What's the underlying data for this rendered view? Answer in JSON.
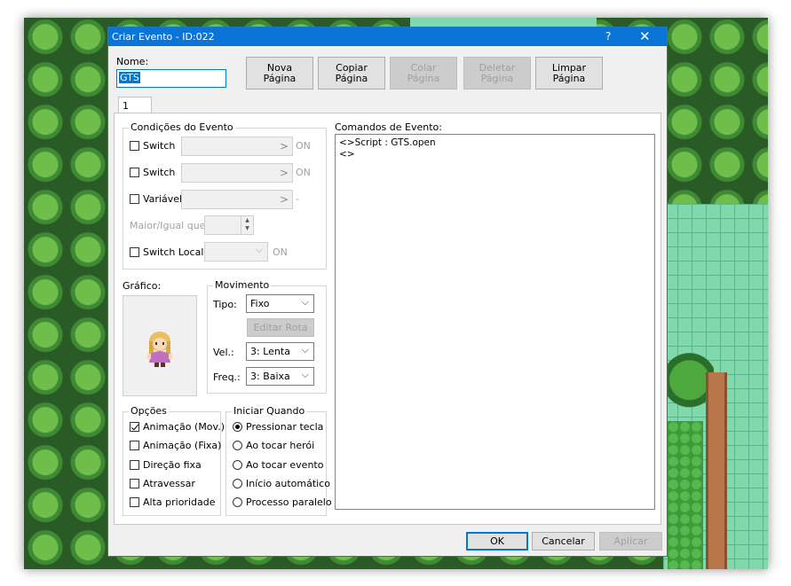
{
  "window": {
    "title": "Criar Evento - ID:022",
    "help": "?",
    "close": "✕"
  },
  "name": {
    "label": "Nome:",
    "value": "GTS"
  },
  "toolbar": {
    "new_page": [
      "Nova",
      "Página"
    ],
    "copy_page": [
      "Copiar",
      "Página"
    ],
    "paste_page": [
      "Colar",
      "Página"
    ],
    "delete_page": [
      "Deletar",
      "Página"
    ],
    "clear_page": [
      "Limpar",
      "Página"
    ]
  },
  "tabs": [
    "1"
  ],
  "conditions": {
    "title": "Condições do Evento",
    "switch1": {
      "label": "Switch",
      "arrow": ">",
      "suffix": "ON"
    },
    "switch2": {
      "label": "Switch",
      "arrow": ">",
      "suffix": "ON"
    },
    "variable": {
      "label": "Variável",
      "arrow": ">",
      "suffix": "-"
    },
    "greater_equal": "Maior/Igual que",
    "local_switch": {
      "label": "Switch Local",
      "suffix": "ON"
    }
  },
  "graphic": {
    "label": "Gráfico:"
  },
  "movement": {
    "title": "Movimento",
    "type_label": "Tipo:",
    "type_value": "Fixo",
    "edit_route": "Editar Rota",
    "speed_label": "Vel.:",
    "speed_value": "3: Lenta",
    "freq_label": "Freq.:",
    "freq_value": "3: Baixa"
  },
  "options": {
    "title": "Opções",
    "items": [
      {
        "label": "Animação (Mov.)",
        "checked": true
      },
      {
        "label": "Animação (Fixa)",
        "checked": false
      },
      {
        "label": "Direção fixa",
        "checked": false
      },
      {
        "label": "Atravessar",
        "checked": false
      },
      {
        "label": "Alta prioridade",
        "checked": false
      }
    ]
  },
  "trigger": {
    "title": "Iniciar Quando",
    "items": [
      {
        "label": "Pressionar tecla",
        "checked": true
      },
      {
        "label": "Ao tocar herói",
        "checked": false
      },
      {
        "label": "Ao tocar evento",
        "checked": false
      },
      {
        "label": "Início automático",
        "checked": false
      },
      {
        "label": "Processo paralelo",
        "checked": false
      }
    ]
  },
  "commands": {
    "label": "Comandos de Evento:",
    "lines": [
      "<>Script : GTS.open",
      "<>"
    ]
  },
  "footer": {
    "ok": "OK",
    "cancel": "Cancelar",
    "apply": "Aplicar"
  },
  "colors": {
    "titlebar": "#0a74d7",
    "selection": "#0078d7",
    "map_grass": "#7fd9ad",
    "map_trees": "#2e6e2a"
  }
}
